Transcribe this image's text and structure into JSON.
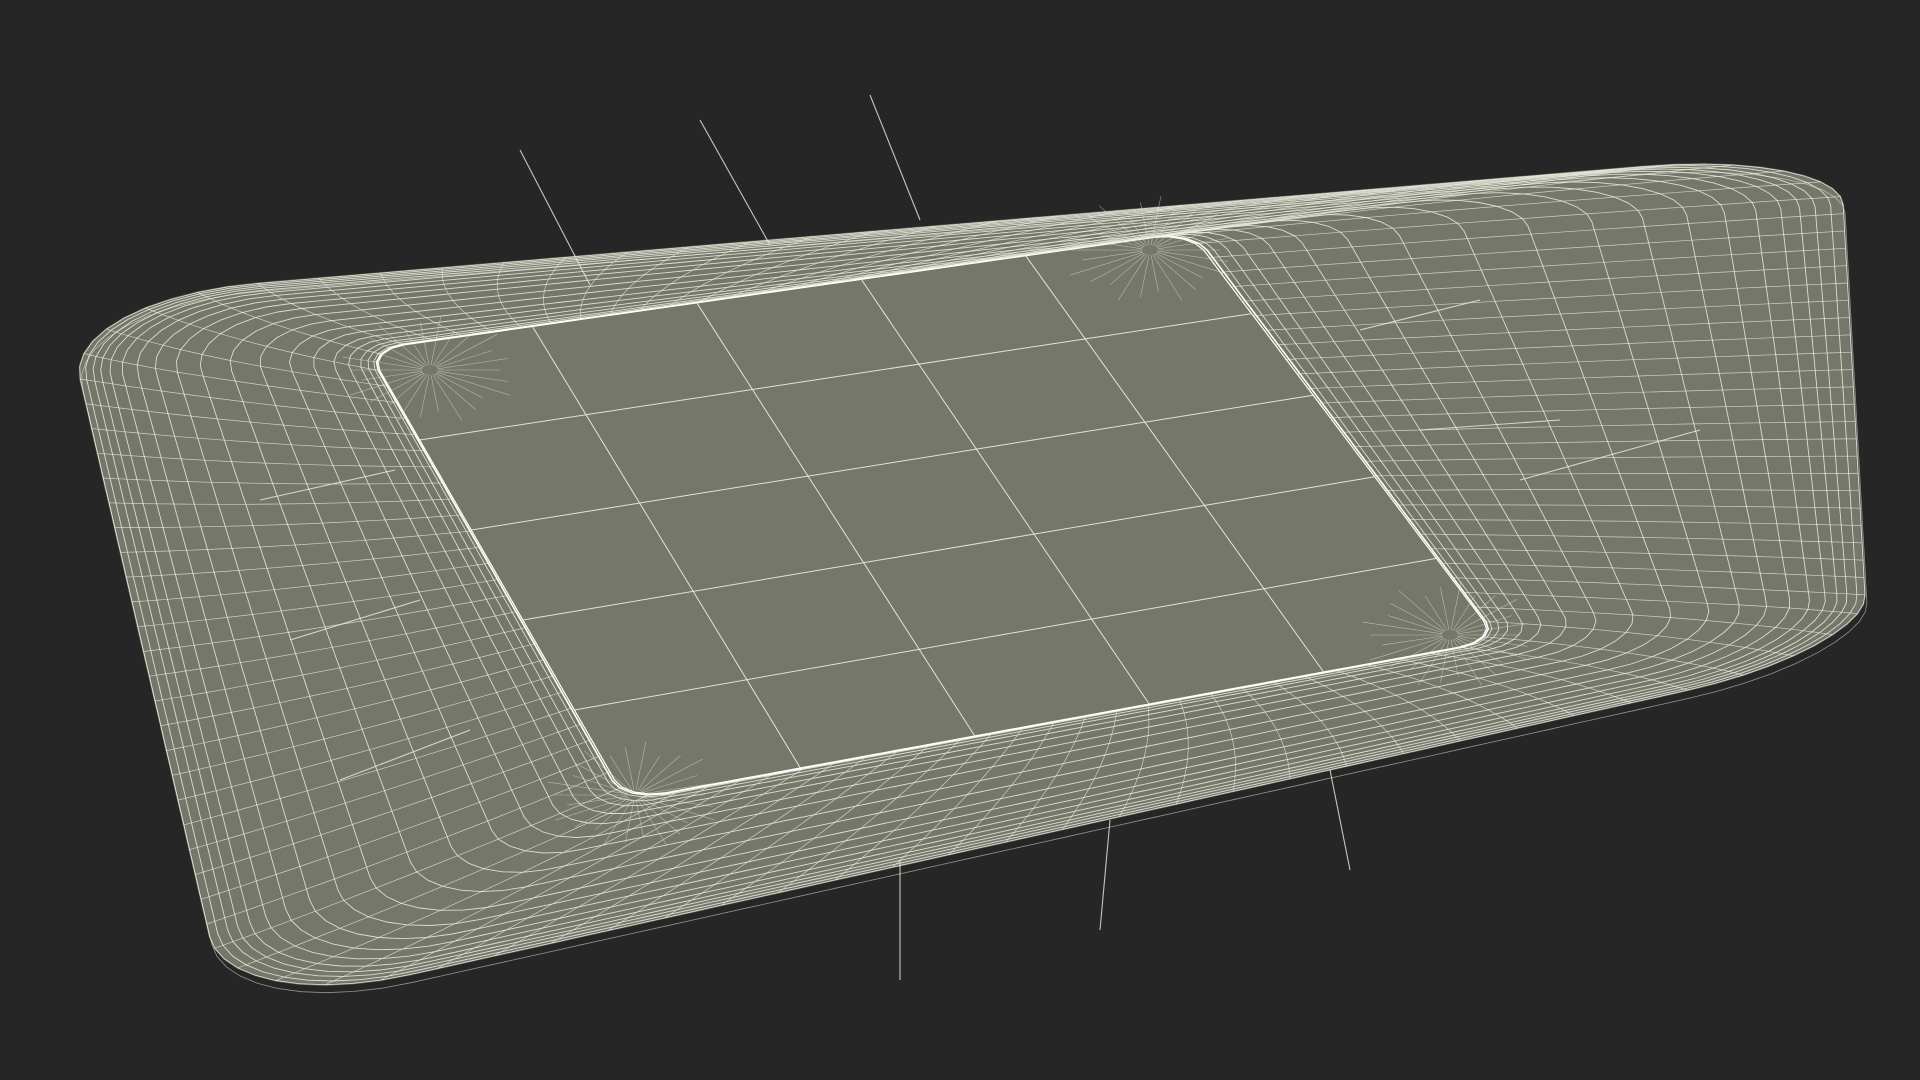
{
  "viewport": {
    "background": "#262626"
  },
  "model": {
    "type": "wireframe-render",
    "subject": "rounded-square-tray",
    "surface_color": "#76776b",
    "wire_color": "#eeeee2",
    "inner_rim_highlight": "#ffffff",
    "edge_color": "#6a6b60"
  }
}
